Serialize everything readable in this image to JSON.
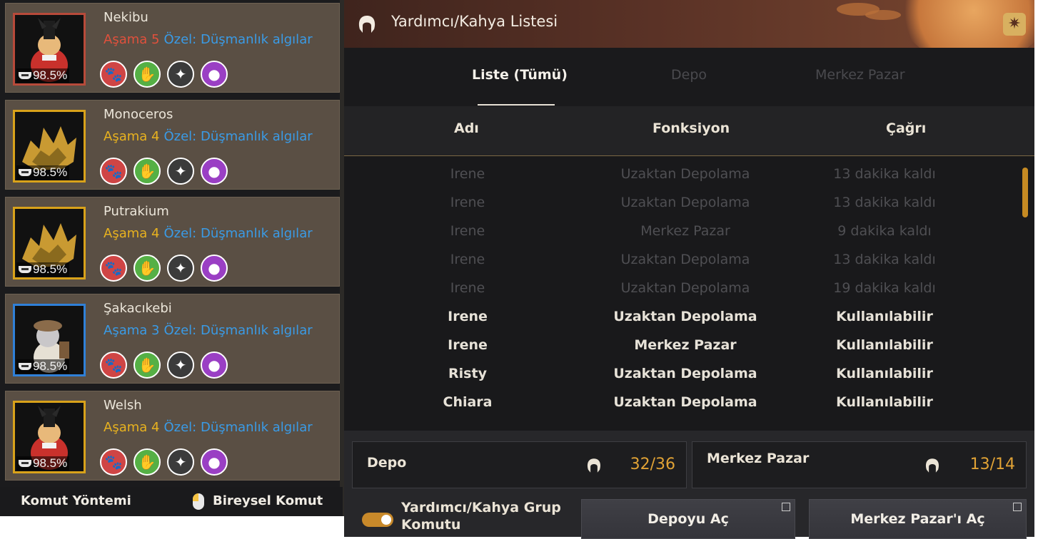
{
  "pets": [
    {
      "name": "Nekibu",
      "stage_label": "Aşama",
      "stage": "5",
      "special": "Özel: Düşmanlık algılar",
      "food": "98.5%",
      "frame": "red",
      "art": "dog"
    },
    {
      "name": "Monoceros",
      "stage_label": "Aşama",
      "stage": "4",
      "special": "Özel: Düşmanlık algılar",
      "food": "98.5%",
      "frame": "gold",
      "art": "beast"
    },
    {
      "name": "Putrakium",
      "stage_label": "Aşama",
      "stage": "4",
      "special": "Özel: Düşmanlık algılar",
      "food": "98.5%",
      "frame": "gold",
      "art": "beast"
    },
    {
      "name": "Şakacıkebi",
      "stage_label": "Aşama",
      "stage": "3",
      "special": "Özel: Düşmanlık algılar",
      "food": "98.5%",
      "frame": "blue",
      "art": "goblin"
    },
    {
      "name": "Welsh",
      "stage_label": "Aşama",
      "stage": "4",
      "special": "Özel: Düşmanlık algılar",
      "food": "98.5%",
      "frame": "gold",
      "art": "dog"
    }
  ],
  "pet_skill_icons": [
    "attack-icon",
    "gather-icon",
    "compass-icon",
    "bag-icon"
  ],
  "command_bar": {
    "label": "Komut Yöntemi",
    "value": "Bireysel Komut"
  },
  "dialog": {
    "title": "Yardımcı/Kahya Listesi",
    "tabs": [
      {
        "label": "Liste (Tümü)",
        "active": true
      },
      {
        "label": "Depo",
        "active": false
      },
      {
        "label": "Merkez Pazar",
        "active": false
      }
    ],
    "columns": [
      "Adı",
      "Fonksiyon",
      "Çağrı"
    ],
    "rows": [
      {
        "name": "Irene",
        "function": "Uzaktan Depolama",
        "status": "13 dakika kaldı",
        "available": false
      },
      {
        "name": "Irene",
        "function": "Uzaktan Depolama",
        "status": "13 dakika kaldı",
        "available": false
      },
      {
        "name": "Irene",
        "function": "Merkez Pazar",
        "status": "9 dakika kaldı",
        "available": false
      },
      {
        "name": "Irene",
        "function": "Uzaktan Depolama",
        "status": "13 dakika kaldı",
        "available": false
      },
      {
        "name": "Irene",
        "function": "Uzaktan Depolama",
        "status": "19 dakika kaldı",
        "available": false
      },
      {
        "name": "Irene",
        "function": "Uzaktan Depolama",
        "status": "Kullanılabilir",
        "available": true
      },
      {
        "name": "Irene",
        "function": "Merkez Pazar",
        "status": "Kullanılabilir",
        "available": true
      },
      {
        "name": "Risty",
        "function": "Uzaktan Depolama",
        "status": "Kullanılabilir",
        "available": true
      },
      {
        "name": "Chiara",
        "function": "Uzaktan Depolama",
        "status": "Kullanılabilir",
        "available": true
      }
    ],
    "summary": [
      {
        "label": "Depo",
        "count": "32/36"
      },
      {
        "label": "Merkez Pazar",
        "count": "13/14"
      }
    ],
    "group_toggle": {
      "label": "Yardımcı/Kahya Grup Komutu",
      "on": true
    },
    "buttons": {
      "open_storage": "Depoyu Aç",
      "open_market": "Merkez Pazar'ı Aç"
    },
    "colors": {
      "accent": "#e0a235",
      "stage_gold": "#e8b21f",
      "stage_red": "#e0503c",
      "stage_blue": "#3a9be6"
    }
  }
}
